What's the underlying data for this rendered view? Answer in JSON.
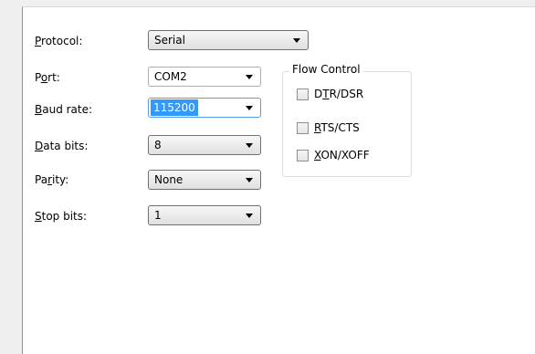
{
  "form": {
    "protocol": {
      "label_pre": "",
      "label_key": "P",
      "label_post": "rotocol:",
      "value": "Serial"
    },
    "port": {
      "label_pre": "P",
      "label_key": "o",
      "label_post": "rt:",
      "value": "COM2"
    },
    "baud_rate": {
      "label_pre": "",
      "label_key": "B",
      "label_post": "aud rate:",
      "value": "115200"
    },
    "data_bits": {
      "label_pre": "",
      "label_key": "D",
      "label_post": "ata bits:",
      "value": "8"
    },
    "parity": {
      "label_pre": "Pa",
      "label_key": "r",
      "label_post": "ity:",
      "value": "None"
    },
    "stop_bits": {
      "label_pre": "",
      "label_key": "S",
      "label_post": "top bits:",
      "value": "1"
    }
  },
  "flow_control": {
    "title": "Flow Control",
    "options": [
      {
        "label_pre": "D",
        "label_key": "T",
        "label_post": "R/DSR",
        "checked": false
      },
      {
        "label_pre": "",
        "label_key": "R",
        "label_post": "TS/CTS",
        "checked": false
      },
      {
        "label_pre": "",
        "label_key": "X",
        "label_post": "ON/XOFF",
        "checked": false
      }
    ]
  },
  "colors": {
    "panel_bg": "#ffffff",
    "window_bg": "#f0f0f0",
    "selection": "#3399ff"
  }
}
